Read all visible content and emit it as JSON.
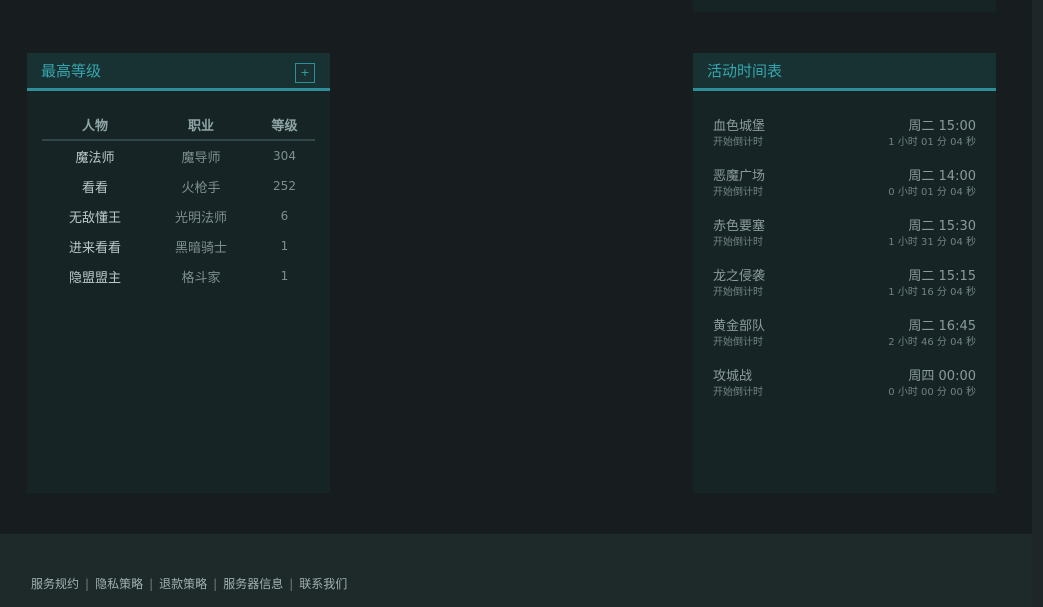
{
  "top_level": {
    "title": "最高等级",
    "expand_label": "+",
    "columns": [
      "人物",
      "职业",
      "等级"
    ],
    "rows": [
      {
        "name": "魔法师",
        "job": "魔导师",
        "level": "304"
      },
      {
        "name": "看看",
        "job": "火枪手",
        "level": "252"
      },
      {
        "name": "无敌懂王",
        "job": "光明法师",
        "level": "6"
      },
      {
        "name": "进来看看",
        "job": "黑暗骑士",
        "level": "1"
      },
      {
        "name": "隐盟盟主",
        "job": "格斗家",
        "level": "1"
      }
    ]
  },
  "schedule": {
    "title": "活动时间表",
    "events": [
      {
        "name": "血色城堡",
        "sub": "开始倒计时",
        "time": "周二 15:00",
        "countdown": "1 小时 01 分 04 秒"
      },
      {
        "name": "恶魔广场",
        "sub": "开始倒计时",
        "time": "周二 14:00",
        "countdown": "0 小时 01 分 04 秒"
      },
      {
        "name": "赤色要塞",
        "sub": "开始倒计时",
        "time": "周二 15:30",
        "countdown": "1 小时 31 分 04 秒"
      },
      {
        "name": "龙之侵袭",
        "sub": "开始倒计时",
        "time": "周二 15:15",
        "countdown": "1 小时 16 分 04 秒"
      },
      {
        "name": "黄金部队",
        "sub": "开始倒计时",
        "time": "周二 16:45",
        "countdown": "2 小时 46 分 04 秒"
      },
      {
        "name": "攻城战",
        "sub": "开始倒计时",
        "time": "周四 00:00",
        "countdown": "0 小时 00 分 00 秒"
      }
    ]
  },
  "footer": {
    "links": [
      "服务规约",
      "隐私策略",
      "退款策略",
      "服务器信息",
      "联系我们"
    ],
    "separator": "|"
  },
  "colors": {
    "background": "#171c1e",
    "panel": "#172426",
    "panel_header": "#183234",
    "accent": "#2f8f98",
    "title_text": "#35a6ad",
    "footer": "#1e2a2a"
  }
}
